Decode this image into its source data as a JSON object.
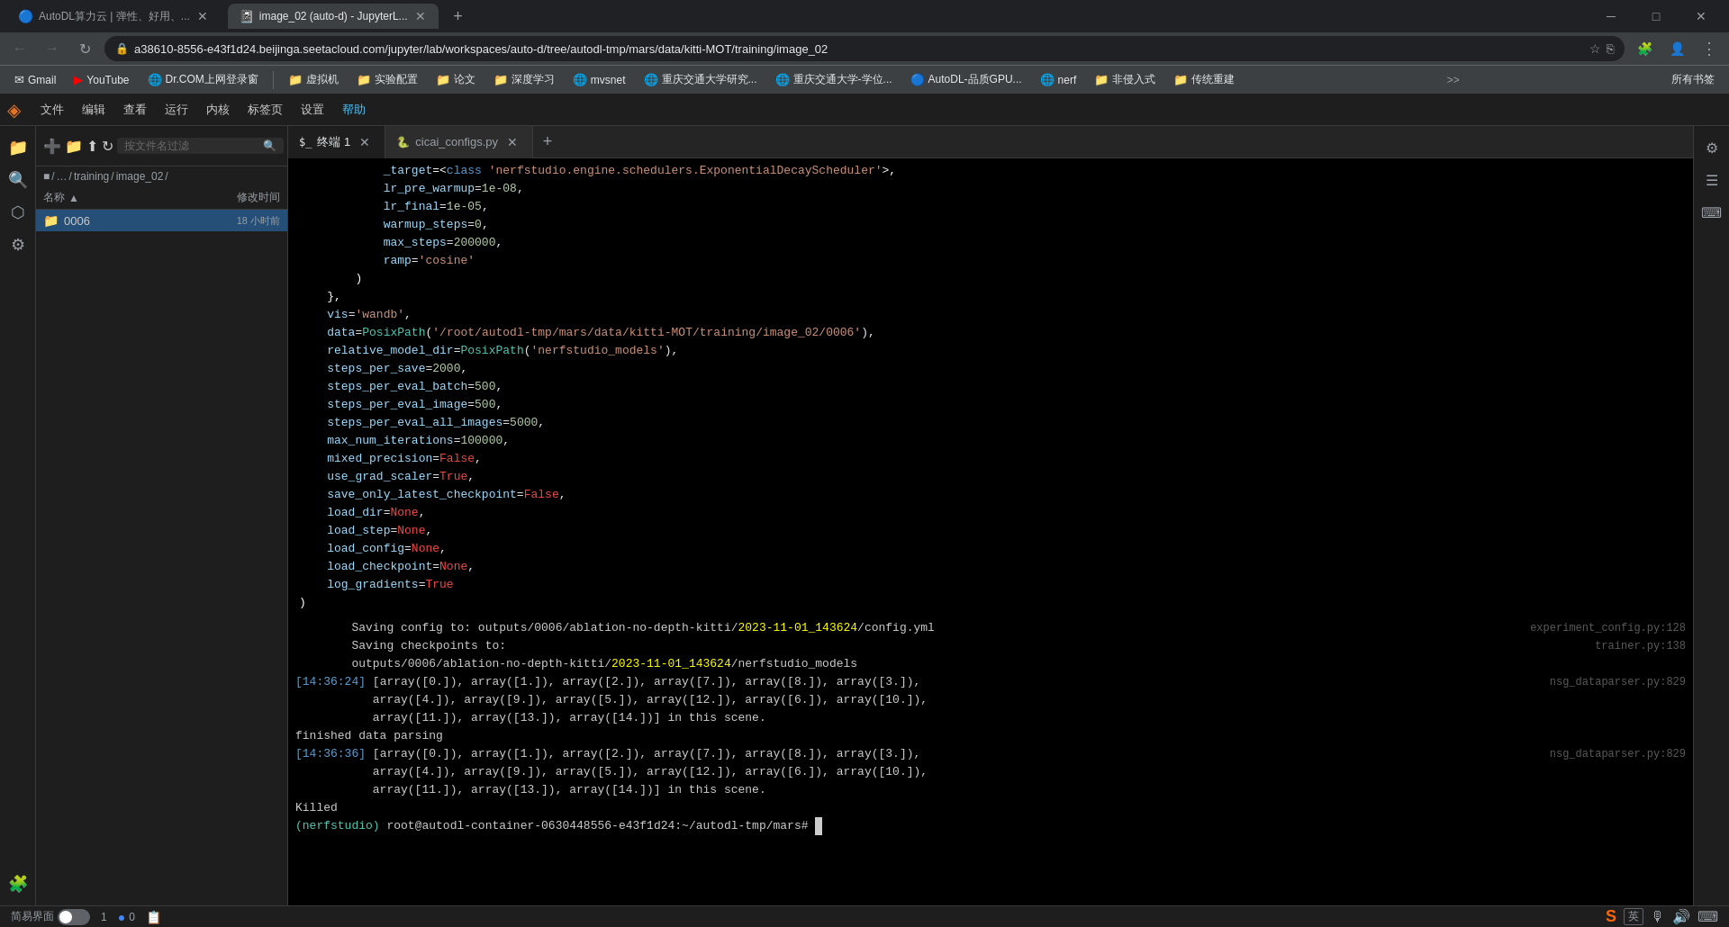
{
  "browser": {
    "tabs": [
      {
        "id": "tab1",
        "favicon": "🔵",
        "label": "AutoDL算力云 | 弹性、好用、...",
        "active": false
      },
      {
        "id": "tab2",
        "favicon": "📓",
        "label": "image_02 (auto-d) - JupyterL...",
        "active": true
      }
    ],
    "new_tab_btn": "+",
    "url": "a38610-8556-e43f1d24.beijinga.seetacloud.com/jupyter/lab/workspaces/auto-d/tree/autodl-tmp/mars/data/kitti-MOT/training/image_02",
    "nav": {
      "back": "←",
      "forward": "→",
      "reload": "↻",
      "home": "⌂"
    },
    "window_controls": {
      "minimize": "─",
      "maximize": "□",
      "close": "✕"
    }
  },
  "bookmarks": [
    {
      "id": "gmail",
      "icon": "✉",
      "label": "Gmail"
    },
    {
      "id": "youtube",
      "icon": "▶",
      "label": "YouTube",
      "color": "#ff0000"
    },
    {
      "id": "drcom",
      "icon": "🌐",
      "label": "Dr.COM上网登录窗"
    },
    {
      "id": "sep1"
    },
    {
      "id": "virt",
      "icon": "📁",
      "label": "虚拟机"
    },
    {
      "id": "expset",
      "icon": "📁",
      "label": "实验配置"
    },
    {
      "id": "paper",
      "icon": "📁",
      "label": "论文"
    },
    {
      "id": "deeplearn",
      "icon": "📁",
      "label": "深度学习"
    },
    {
      "id": "mvsnet",
      "icon": "🌐",
      "label": "mvsnet"
    },
    {
      "id": "jiaotong",
      "icon": "🌐",
      "label": "重庆交通大学研究..."
    },
    {
      "id": "jiaotong2",
      "icon": "🌐",
      "label": "重庆交通大学-学位..."
    },
    {
      "id": "autodl",
      "icon": "🔵",
      "label": "AutoDL-品质GPU..."
    },
    {
      "id": "nerf",
      "icon": "🌐",
      "label": "nerf"
    },
    {
      "id": "noninvasive",
      "icon": "📁",
      "label": "非侵入式"
    },
    {
      "id": "traditional",
      "icon": "📁",
      "label": "传统重建"
    },
    {
      "id": "more",
      "label": ">>"
    }
  ],
  "jupyter": {
    "menu_items": [
      "文件",
      "编辑",
      "查看",
      "运行",
      "内核",
      "标签页",
      "设置",
      "帮助"
    ],
    "logo": "⬡",
    "tabs": [
      {
        "id": "terminal",
        "label": "终端 1",
        "icon": ">_",
        "active": true
      },
      {
        "id": "config",
        "label": "cicai_configs.py",
        "icon": "🐍",
        "active": false
      }
    ],
    "new_tab": "+"
  },
  "sidebar": {
    "icons": [
      "📁",
      "🔍",
      "⚙",
      "🔌"
    ],
    "breadcrumb": [
      "■",
      "/",
      "…",
      "/",
      "training",
      "/",
      "image_02",
      "/"
    ],
    "headers": {
      "name": "名称",
      "sort_icon": "▲",
      "modified": "修改时间"
    },
    "files": [
      {
        "id": "0006",
        "name": "0006",
        "type": "folder",
        "modified": "18 小时前",
        "selected": true
      }
    ]
  },
  "right_sidebar_icons": [
    "⚙",
    "🔧",
    "📊",
    "⬚"
  ],
  "code": {
    "lines": [
      {
        "content": "            _target=<class 'nerfstudio.engine.schedulers.ExponentialDecayScheduler'>,",
        "colors": [
          "c-white"
        ]
      },
      {
        "content": "            lr_pre_warmup=1e-08,",
        "colors": []
      },
      {
        "content": "            lr_final=1e-05,",
        "colors": []
      },
      {
        "content": "            warmup_steps=0,",
        "colors": []
      },
      {
        "content": "            max_steps=200000,",
        "colors": []
      },
      {
        "content": "            ramp='cosine'",
        "colors": []
      },
      {
        "content": "        )",
        "colors": []
      },
      {
        "content": "    },",
        "colors": []
      },
      {
        "content": "    vis='wandb',",
        "colors": []
      },
      {
        "content": "    data=PosixPath('/root/autodl-tmp/mars/data/kitti-MOT/training/image_02/0006'),",
        "colors": []
      },
      {
        "content": "    relative_model_dir=PosixPath('nerfstudio_models'),",
        "colors": []
      },
      {
        "content": "    steps_per_save=2000,",
        "colors": []
      },
      {
        "content": "    steps_per_eval_batch=500,",
        "colors": []
      },
      {
        "content": "    steps_per_eval_image=500,",
        "colors": []
      },
      {
        "content": "    steps_per_eval_all_images=5000,",
        "colors": []
      },
      {
        "content": "    max_num_iterations=100000,",
        "colors": []
      },
      {
        "content": "    mixed_precision=False,",
        "colors": []
      },
      {
        "content": "    use_grad_scaler=True,",
        "colors": []
      },
      {
        "content": "    save_only_latest_checkpoint=False,",
        "colors": []
      },
      {
        "content": "    load_dir=None,",
        "colors": []
      },
      {
        "content": "    load_step=None,",
        "colors": []
      },
      {
        "content": "    load_config=None,",
        "colors": []
      },
      {
        "content": "    load_checkpoint=None,",
        "colors": []
      },
      {
        "content": "    log_gradients=True",
        "colors": []
      },
      {
        "content": ")",
        "colors": []
      }
    ]
  },
  "terminal": {
    "lines": [
      {
        "text": "        Saving config to: outputs/0006/ablation-no-depth-kitti/2023-11-01_143624/config.yml",
        "source": "experiment_config.py:128",
        "indent": "        "
      },
      {
        "text": "        Saving checkpoints to:",
        "source": "trainer.py:138",
        "indent": "        "
      },
      {
        "text": "        outputs/0006/ablation-no-depth-kitti/2023-11-01_143624/nerfstudio_models",
        "source": "",
        "indent": "        "
      },
      {
        "text": "[14:36:24] [array([0.]), array([1.]), array([2.]), array([7.]), array([8.]), array([3.]),",
        "source": "nsg_dataparser.py:829",
        "indent": ""
      },
      {
        "text": "           array([4.]), array([9.]), array([5.]), array([12.]), array([6.]), array([10.]),",
        "source": "",
        "indent": ""
      },
      {
        "text": "           array([11.]), array([13.]), array([14.])] in this scene.",
        "source": "",
        "indent": ""
      },
      {
        "text": "finished data parsing",
        "source": "",
        "indent": ""
      },
      {
        "text": "[14:36:36] [array([0.]), array([1.]), array([2.]), array([7.]), array([8.]), array([3.]),",
        "source": "nsg_dataparser.py:829",
        "indent": ""
      },
      {
        "text": "           array([4.]), array([9.]), array([5.]), array([12.]), array([6.]), array([10.]),",
        "source": "",
        "indent": ""
      },
      {
        "text": "           array([11.]), array([13.]), array([14.])] in this scene.",
        "source": "",
        "indent": ""
      },
      {
        "text": "Killed",
        "source": "",
        "indent": ""
      },
      {
        "text": "(nerfstudio) root@autodl-container-0630448556-e43f1d24:~/autodl-tmp/mars# ",
        "source": "",
        "indent": "",
        "is_prompt": true
      }
    ]
  },
  "status_bar": {
    "simple_interface": "简易界面",
    "toggle_state": false,
    "numbers": "1",
    "zero": "0",
    "icon1": "📋",
    "sougou_label": "英",
    "mic_label": "🎙",
    "speaker_label": "🔊"
  }
}
